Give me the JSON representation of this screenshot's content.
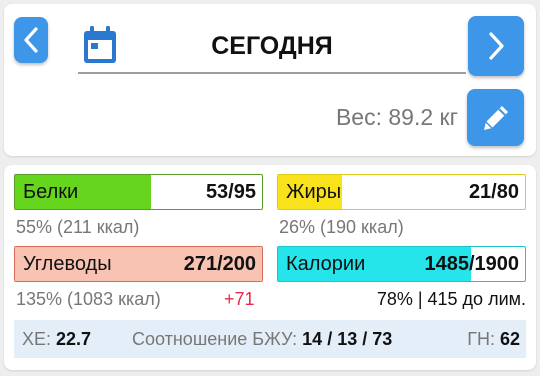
{
  "header": {
    "date_title": "СЕГОДНЯ",
    "weight_text": "Вес: 89.2 кг",
    "icons": [
      "chevron-left-icon",
      "calendar-icon",
      "chevron-right-icon",
      "pencil-icon"
    ]
  },
  "macros": {
    "protein": {
      "label": "Белки",
      "value": "53/95",
      "percent_fill": 55,
      "sub": "55% (211 ккал)",
      "color": "#66d51e"
    },
    "fat": {
      "label": "Жиры",
      "value": "21/80",
      "percent_fill": 26,
      "sub": "26% (190 ккал)",
      "color": "#f8e21b"
    },
    "carbs": {
      "label": "Углеводы",
      "value": "271/200",
      "percent_fill": 100,
      "sub": "135% (1083 ккал)",
      "excess": "+71",
      "color": "#f9c3b4"
    },
    "calories": {
      "label": "Калории",
      "value": "1485/1900",
      "percent_fill": 78,
      "sub": "78% | 415 до лим.",
      "color": "#25e4ea"
    }
  },
  "stats": {
    "xe_label": "ХЕ:",
    "xe_value": "22.7",
    "ratio_label": "Соотношение БЖУ:",
    "ratio_value": "14 / 13 / 73",
    "gi_label": "ГН:",
    "gi_value": "62"
  },
  "colors": {
    "accent": "#3d96e8",
    "excess": "#e8294b",
    "stats_bg": "#e4eef9"
  }
}
